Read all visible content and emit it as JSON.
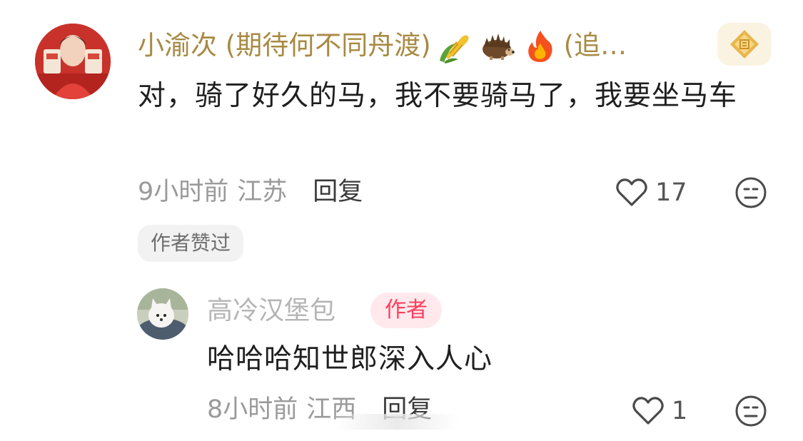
{
  "comment": {
    "user": {
      "name": "小渝次 (期待何不同舟渡)",
      "suffix": "(追…",
      "emojis": [
        "🌽",
        "🦔",
        "🔥"
      ]
    },
    "text": "对，骑了好久的马，我不要骑马了，我要坐马车",
    "time": "9小时前",
    "location": "江苏",
    "reply_label": "回复",
    "likes": "17",
    "author_liked_label": "作者赞过"
  },
  "reply": {
    "user": {
      "name": "高冷汉堡包",
      "tag": "作者"
    },
    "text": "哈哈哈知世郎深入人心",
    "time": "8小时前",
    "location": "江西",
    "reply_label": "回复",
    "likes": "1"
  },
  "colors": {
    "username_gold": "#a88a43",
    "author_tag": "#ff3e5e",
    "author_tag_bg": "#ffe9ec",
    "badge_bg": "#fbf3e2"
  }
}
